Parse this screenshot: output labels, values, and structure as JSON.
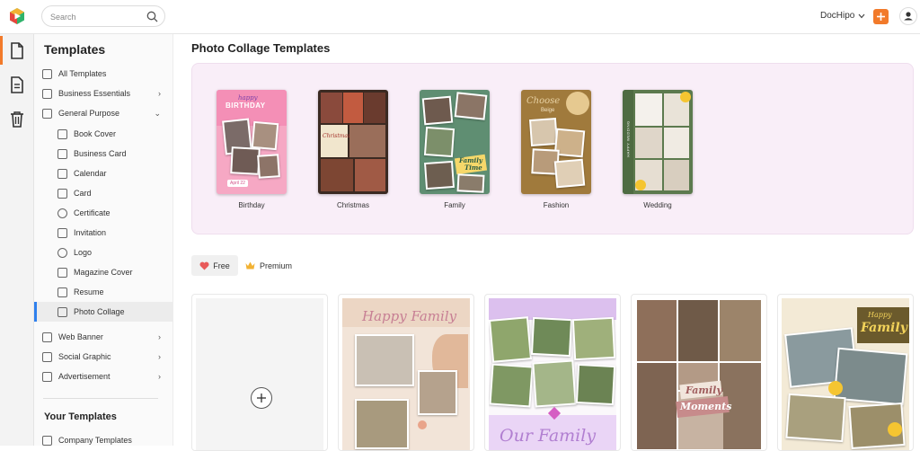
{
  "search": {
    "placeholder": "Search"
  },
  "account": {
    "name": "DocHipo"
  },
  "sidebar": {
    "title": "Templates",
    "items": [
      {
        "label": "All Templates"
      },
      {
        "label": "Business Essentials"
      },
      {
        "label": "General Purpose"
      },
      {
        "label": "Book Cover"
      },
      {
        "label": "Business Card"
      },
      {
        "label": "Calendar"
      },
      {
        "label": "Card"
      },
      {
        "label": "Certificate"
      },
      {
        "label": "Invitation"
      },
      {
        "label": "Logo"
      },
      {
        "label": "Magazine Cover"
      },
      {
        "label": "Resume"
      },
      {
        "label": "Photo Collage"
      },
      {
        "label": "Web Banner"
      },
      {
        "label": "Social Graphic"
      },
      {
        "label": "Advertisement"
      }
    ],
    "your_templates_title": "Your Templates",
    "company_templates": "Company Templates"
  },
  "main": {
    "title": "Photo Collage Templates",
    "featured": [
      {
        "label": "Birthday",
        "text1": "happy",
        "text2": "BIRTHDAY",
        "tag": "April 22"
      },
      {
        "label": "Christmas",
        "text1": "Christmas"
      },
      {
        "label": "Family",
        "text1": "Family",
        "text2": "Time"
      },
      {
        "label": "Fashion",
        "text1": "Choose",
        "text2": "Beige"
      },
      {
        "label": "Wedding",
        "text1": "HAPPY WEDDING"
      }
    ],
    "filters": {
      "free": "Free",
      "premium": "Premium"
    },
    "cards": [
      {
        "title": "Happy Family"
      },
      {
        "title": "Our Family"
      },
      {
        "title1": "Family",
        "title2": "Moments"
      },
      {
        "title1": "Happy",
        "title2": "Family"
      }
    ]
  },
  "colors": {
    "accent": "#f27a2a",
    "active_bar": "#2f80ed",
    "featured_bg": "#f9eef8"
  }
}
